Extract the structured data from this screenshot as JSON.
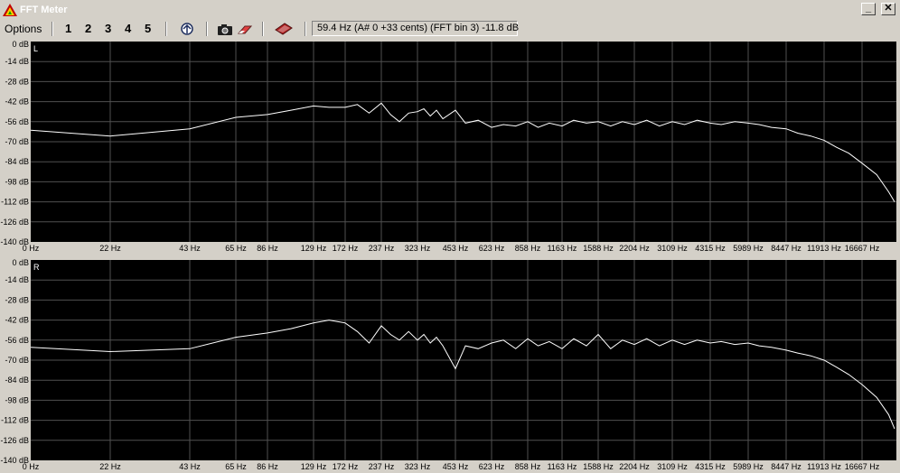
{
  "window": {
    "title": "FFT Meter",
    "minimize_label": "_",
    "close_label": "✕"
  },
  "toolbar": {
    "options_label": "Options",
    "presets": [
      "1",
      "2",
      "3",
      "4",
      "5"
    ],
    "icons": [
      "freeze-icon",
      "camera-icon",
      "eraser-icon",
      "book-icon"
    ],
    "status_text": "59.4 Hz (A# 0 +33 cents) (FFT bin 3) -11.8 dB"
  },
  "colors": {
    "plot_bg": "#000000",
    "grid": "#505050",
    "trace": "#ffffff",
    "frame": "#d4d0c8"
  },
  "chart_data": [
    {
      "type": "line",
      "channel_label": "L",
      "y_ticks": [
        "0 dB",
        "-14 dB",
        "-28 dB",
        "-42 dB",
        "-56 dB",
        "-70 dB",
        "-84 dB",
        "-98 dB",
        "-112 dB",
        "-126 dB",
        "-140 dB"
      ],
      "x_ticks": [
        "0 Hz",
        "22 Hz",
        "43 Hz",
        "65 Hz",
        "86 Hz",
        "129 Hz",
        "172 Hz",
        "237 Hz",
        "323 Hz",
        "453 Hz",
        "623 Hz",
        "858 Hz",
        "1163 Hz",
        "1588 Hz",
        "2204 Hz",
        "3109 Hz",
        "4315 Hz",
        "5989 Hz",
        "8447 Hz",
        "11913 Hz",
        "16667 Hz"
      ],
      "ylim": [
        -140,
        0
      ],
      "grid": true,
      "series": [
        {
          "values": [
            [
              0,
              -62
            ],
            [
              22,
              -66
            ],
            [
              43,
              -61
            ],
            [
              65,
              -53
            ],
            [
              86,
              -51
            ],
            [
              108,
              -48
            ],
            [
              129,
              -45
            ],
            [
              150,
              -46
            ],
            [
              172,
              -46
            ],
            [
              194,
              -44
            ],
            [
              215,
              -50
            ],
            [
              237,
              -43
            ],
            [
              259,
              -51
            ],
            [
              280,
              -56
            ],
            [
              302,
              -50
            ],
            [
              323,
              -49
            ],
            [
              345,
              -47
            ],
            [
              367,
              -52
            ],
            [
              388,
              -48
            ],
            [
              410,
              -54
            ],
            [
              453,
              -48
            ],
            [
              500,
              -57
            ],
            [
              560,
              -55
            ],
            [
              623,
              -60
            ],
            [
              700,
              -58
            ],
            [
              780,
              -59
            ],
            [
              858,
              -56
            ],
            [
              950,
              -60
            ],
            [
              1050,
              -57
            ],
            [
              1163,
              -59
            ],
            [
              1300,
              -55
            ],
            [
              1450,
              -57
            ],
            [
              1588,
              -56
            ],
            [
              1800,
              -59
            ],
            [
              2000,
              -56
            ],
            [
              2204,
              -58
            ],
            [
              2500,
              -55
            ],
            [
              2800,
              -59
            ],
            [
              3109,
              -56
            ],
            [
              3500,
              -58
            ],
            [
              3900,
              -55
            ],
            [
              4315,
              -57
            ],
            [
              4800,
              -58
            ],
            [
              5400,
              -56
            ],
            [
              5989,
              -57
            ],
            [
              6700,
              -58
            ],
            [
              7500,
              -60
            ],
            [
              8447,
              -61
            ],
            [
              9500,
              -64
            ],
            [
              10700,
              -66
            ],
            [
              11913,
              -69
            ],
            [
              13500,
              -74
            ],
            [
              15000,
              -78
            ],
            [
              16667,
              -85
            ],
            [
              18500,
              -93
            ],
            [
              20000,
              -105
            ],
            [
              21000,
              -112
            ]
          ]
        }
      ]
    },
    {
      "type": "line",
      "channel_label": "R",
      "y_ticks": [
        "0 dB",
        "-14 dB",
        "-28 dB",
        "-42 dB",
        "-56 dB",
        "-70 dB",
        "-84 dB",
        "-98 dB",
        "-112 dB",
        "-126 dB",
        "-140 dB"
      ],
      "x_ticks": [
        "0 Hz",
        "22 Hz",
        "43 Hz",
        "65 Hz",
        "86 Hz",
        "129 Hz",
        "172 Hz",
        "237 Hz",
        "323 Hz",
        "453 Hz",
        "623 Hz",
        "858 Hz",
        "1163 Hz",
        "1588 Hz",
        "2204 Hz",
        "3109 Hz",
        "4315 Hz",
        "5989 Hz",
        "8447 Hz",
        "11913 Hz",
        "16667 Hz"
      ],
      "ylim": [
        -140,
        0
      ],
      "grid": true,
      "series": [
        {
          "values": [
            [
              0,
              -61
            ],
            [
              22,
              -64
            ],
            [
              43,
              -62
            ],
            [
              65,
              -54
            ],
            [
              86,
              -51
            ],
            [
              108,
              -48
            ],
            [
              129,
              -44
            ],
            [
              150,
              -42
            ],
            [
              172,
              -44
            ],
            [
              194,
              -50
            ],
            [
              215,
              -58
            ],
            [
              237,
              -46
            ],
            [
              259,
              -52
            ],
            [
              280,
              -56
            ],
            [
              302,
              -50
            ],
            [
              323,
              -56
            ],
            [
              345,
              -52
            ],
            [
              367,
              -58
            ],
            [
              388,
              -54
            ],
            [
              410,
              -60
            ],
            [
              453,
              -76
            ],
            [
              500,
              -60
            ],
            [
              560,
              -62
            ],
            [
              623,
              -58
            ],
            [
              700,
              -56
            ],
            [
              780,
              -62
            ],
            [
              858,
              -55
            ],
            [
              950,
              -60
            ],
            [
              1050,
              -57
            ],
            [
              1163,
              -62
            ],
            [
              1300,
              -55
            ],
            [
              1450,
              -60
            ],
            [
              1588,
              -52
            ],
            [
              1800,
              -62
            ],
            [
              2000,
              -56
            ],
            [
              2204,
              -59
            ],
            [
              2500,
              -55
            ],
            [
              2800,
              -60
            ],
            [
              3109,
              -56
            ],
            [
              3500,
              -59
            ],
            [
              3900,
              -56
            ],
            [
              4315,
              -58
            ],
            [
              4800,
              -57
            ],
            [
              5400,
              -59
            ],
            [
              5989,
              -58
            ],
            [
              6700,
              -60
            ],
            [
              7500,
              -61
            ],
            [
              8447,
              -63
            ],
            [
              9500,
              -65
            ],
            [
              10700,
              -67
            ],
            [
              11913,
              -70
            ],
            [
              13500,
              -75
            ],
            [
              15000,
              -80
            ],
            [
              16667,
              -87
            ],
            [
              18500,
              -96
            ],
            [
              20000,
              -108
            ],
            [
              21000,
              -118
            ]
          ]
        }
      ]
    }
  ]
}
